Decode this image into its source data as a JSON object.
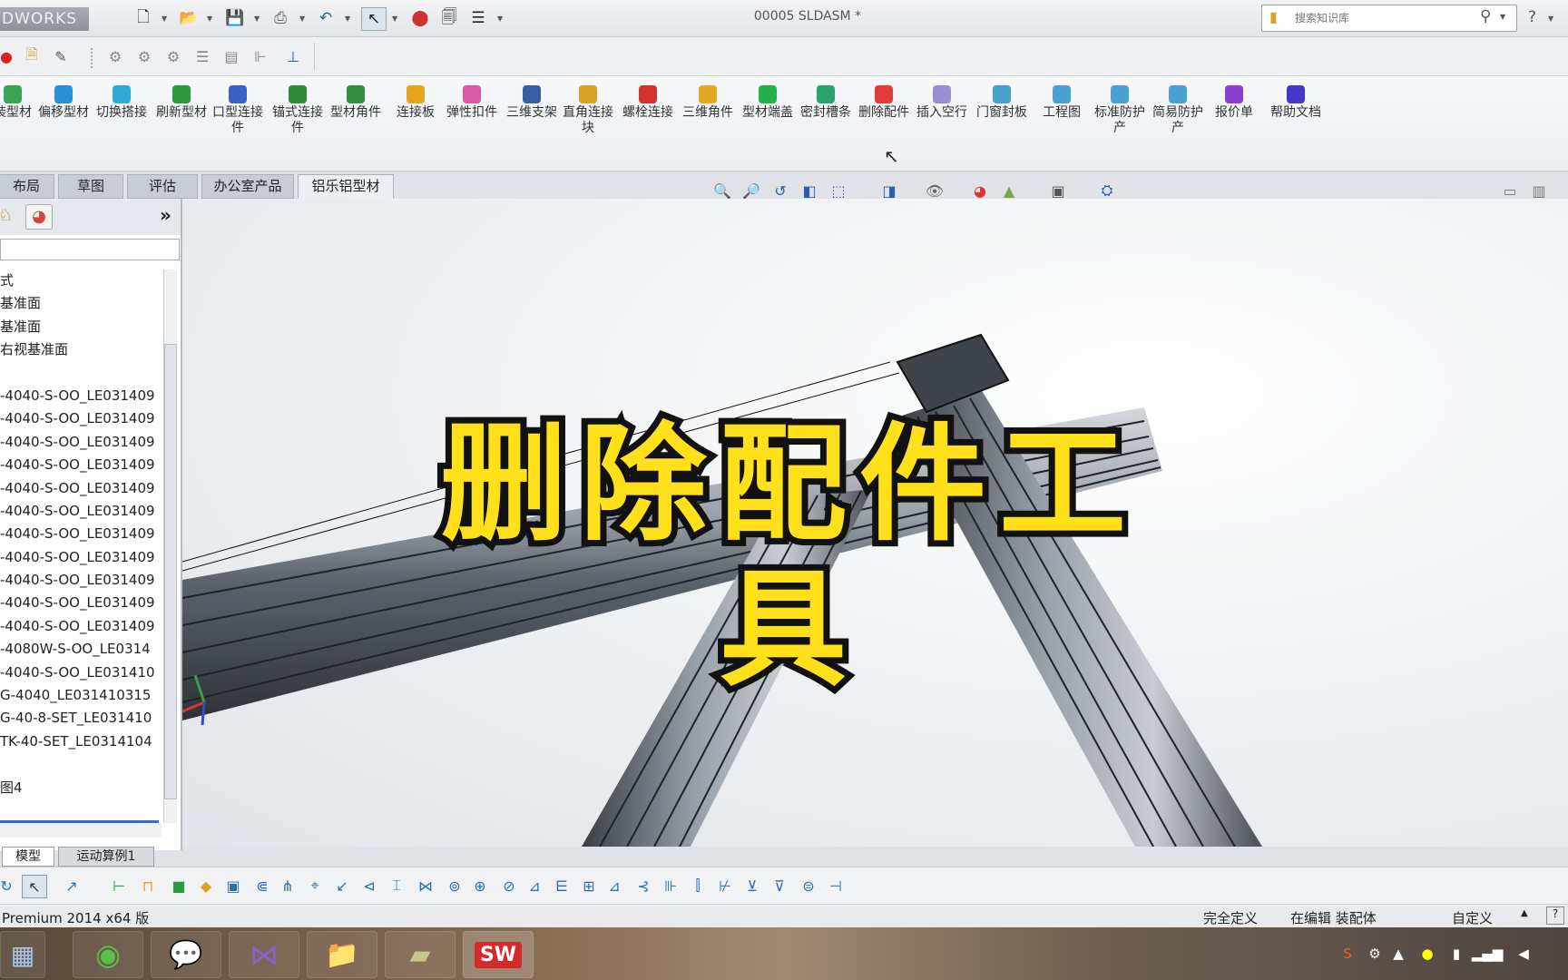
{
  "window": {
    "brand": "DWORKS",
    "doc_title": "00005 SLDASM *",
    "search_placeholder": "搜索知识库",
    "help_glyph": "?"
  },
  "colors": {
    "overlay_text": "#ffe01a",
    "overlay_stroke": "#111111",
    "selection_blue": "#2f6fd0"
  },
  "command_manager": [
    {
      "label": "装型材",
      "icon": "profile-icon",
      "color": "#3aa655"
    },
    {
      "label": "偏移型材",
      "icon": "offset-profile-icon",
      "color": "#2b8fd6"
    },
    {
      "label": "切换搭接",
      "icon": "switch-lap-icon",
      "color": "#31a9d8"
    },
    {
      "label": "刷新型材",
      "icon": "refresh-profile-icon",
      "color": "#2e9b3e"
    },
    {
      "label": "口型连接件",
      "icon": "mouth-connector-icon",
      "color": "#3a62c4"
    },
    {
      "label": "锚式连接件",
      "icon": "anchor-connector-icon",
      "color": "#2e8b3a"
    },
    {
      "label": "型材角件",
      "icon": "profile-corner-icon",
      "color": "#2f8f40"
    },
    {
      "label": "连接板",
      "icon": "connection-plate-icon",
      "color": "#e6a41f"
    },
    {
      "label": "弹性扣件",
      "icon": "elastic-fastener-icon",
      "color": "#d85aa6"
    },
    {
      "label": "三维支架",
      "icon": "3d-bracket-icon",
      "color": "#3b5ea8"
    },
    {
      "label": "直角连接块",
      "icon": "right-angle-block-icon",
      "color": "#d9a12a"
    },
    {
      "label": "螺栓连接",
      "icon": "bolt-connect-icon",
      "color": "#d4322b"
    },
    {
      "label": "三维角件",
      "icon": "3d-corner-icon",
      "color": "#e1a820"
    },
    {
      "label": "型材端盖",
      "icon": "end-cap-icon",
      "color": "#22b14c"
    },
    {
      "label": "密封槽条",
      "icon": "seal-strip-icon",
      "color": "#2aa36a"
    },
    {
      "label": "删除配件",
      "icon": "delete-fitting-icon",
      "color": "#e23b3b"
    },
    {
      "label": "插入空行",
      "icon": "insert-row-icon",
      "color": "#9a8ed0"
    },
    {
      "label": "门窗封板",
      "icon": "door-panel-icon",
      "color": "#4aa0d0"
    },
    {
      "label": "工程图",
      "icon": "drawing-icon",
      "color": "#4aa0d0"
    },
    {
      "label": "标准防护产",
      "icon": "guard-icon",
      "color": "#4aa0d0"
    },
    {
      "label": "简易防护产",
      "icon": "simple-guard-icon",
      "color": "#4aa0d0"
    },
    {
      "label": "报价单",
      "icon": "quote-icon",
      "color": "#8b3fd0"
    },
    {
      "label": "帮助文档",
      "icon": "help-doc-icon",
      "color": "#4338c9"
    }
  ],
  "tabs": [
    "布局",
    "草图",
    "评估",
    "办公室产品",
    "铝乐铝型材"
  ],
  "active_tab": 4,
  "tree": [
    "式",
    "基准面",
    "基准面",
    "右视基准面",
    "",
    "-4040-S-OO_LE031409",
    "-4040-S-OO_LE031409",
    "-4040-S-OO_LE031409",
    "-4040-S-OO_LE031409",
    "-4040-S-OO_LE031409",
    "-4040-S-OO_LE031409",
    "-4040-S-OO_LE031409",
    "-4040-S-OO_LE031409",
    "-4040-S-OO_LE031409",
    "-4040-S-OO_LE031409",
    "-4040-S-OO_LE031409",
    "-4080W-S-OO_LE0314",
    "-4040-S-OO_LE031410",
    "G-4040_LE031410315",
    "G-40-8-SET_LE031410",
    "TK-40-SET_LE0314104",
    "",
    "图4"
  ],
  "overlay_title": "删除配件工具",
  "bottom_tabs": [
    "模型",
    "运动算例1"
  ],
  "status": {
    "left": "Premium 2014 x64 版",
    "state1": "完全定义",
    "state2": "在编辑 装配体",
    "custom": "自定义"
  }
}
